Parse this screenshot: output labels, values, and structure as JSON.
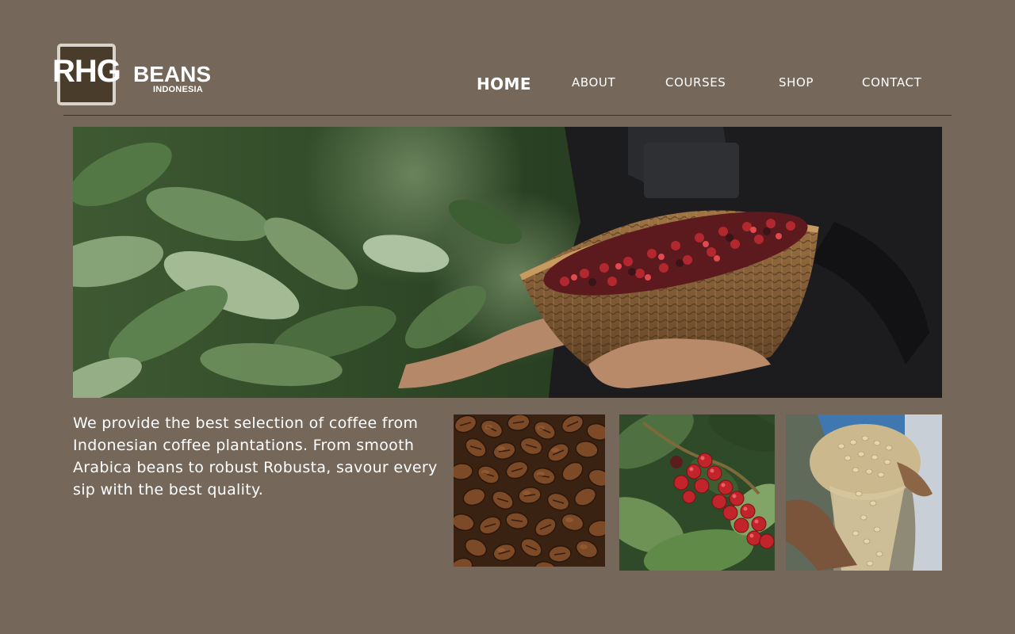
{
  "brand": {
    "mark": "RHG",
    "word": "BEANS",
    "sub": "INDONESIA"
  },
  "nav": {
    "items": [
      {
        "label": "HOME",
        "active": true
      },
      {
        "label": "ABOUT",
        "active": false
      },
      {
        "label": "COURSES",
        "active": false
      },
      {
        "label": "SHOP",
        "active": false
      },
      {
        "label": "CONTACT",
        "active": false
      }
    ]
  },
  "intro": {
    "text": "We provide the best selection of coffee from Indonesian coffee plantations. From smooth Arabica beans to robust Robusta, savour every sip with the best quality."
  },
  "images": {
    "hero": "coffee-harvest-basket-photo",
    "thumbs": [
      "roasted-coffee-beans-photo",
      "red-coffee-cherries-photo",
      "green-coffee-beans-photo"
    ]
  },
  "colors": {
    "background": "#75685b",
    "divider": "#3d342b",
    "text": "#ffffff",
    "logo_box": "#4a3c2b"
  }
}
